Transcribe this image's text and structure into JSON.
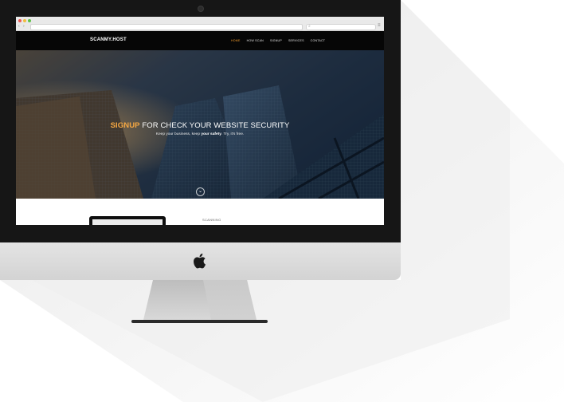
{
  "browser": {
    "url": "",
    "search_placeholder": "",
    "back_glyph": "‹",
    "forward_glyph": "›",
    "search_glyph": "⌕",
    "menu_glyph": "≡"
  },
  "site": {
    "logo": "SCANMY.HOST",
    "nav": [
      {
        "label": "HOME",
        "active": true
      },
      {
        "label": "HOW SCAN",
        "active": false
      },
      {
        "label": "SIGNUP",
        "active": false
      },
      {
        "label": "SERVICES",
        "active": false
      },
      {
        "label": "CONTACT",
        "active": false
      }
    ]
  },
  "hero": {
    "title_accent": "SIGNUP",
    "title_rest": " FOR CHECK YOUR WEBSITE SECURITY",
    "subtitle_pre": "Keep your business, keep ",
    "subtitle_bold": "your safety",
    "subtitle_post": ". Try, it's free.",
    "scroll_glyph": "⌄"
  },
  "lower": {
    "scanning_label": "SCANNING"
  },
  "colors": {
    "accent": "#f5a742",
    "nav_bg": "#060606",
    "bezel": "#161616",
    "chin": "#dcdcdc"
  },
  "icons": {
    "apple": "apple-logo",
    "camera": "camera-icon"
  }
}
